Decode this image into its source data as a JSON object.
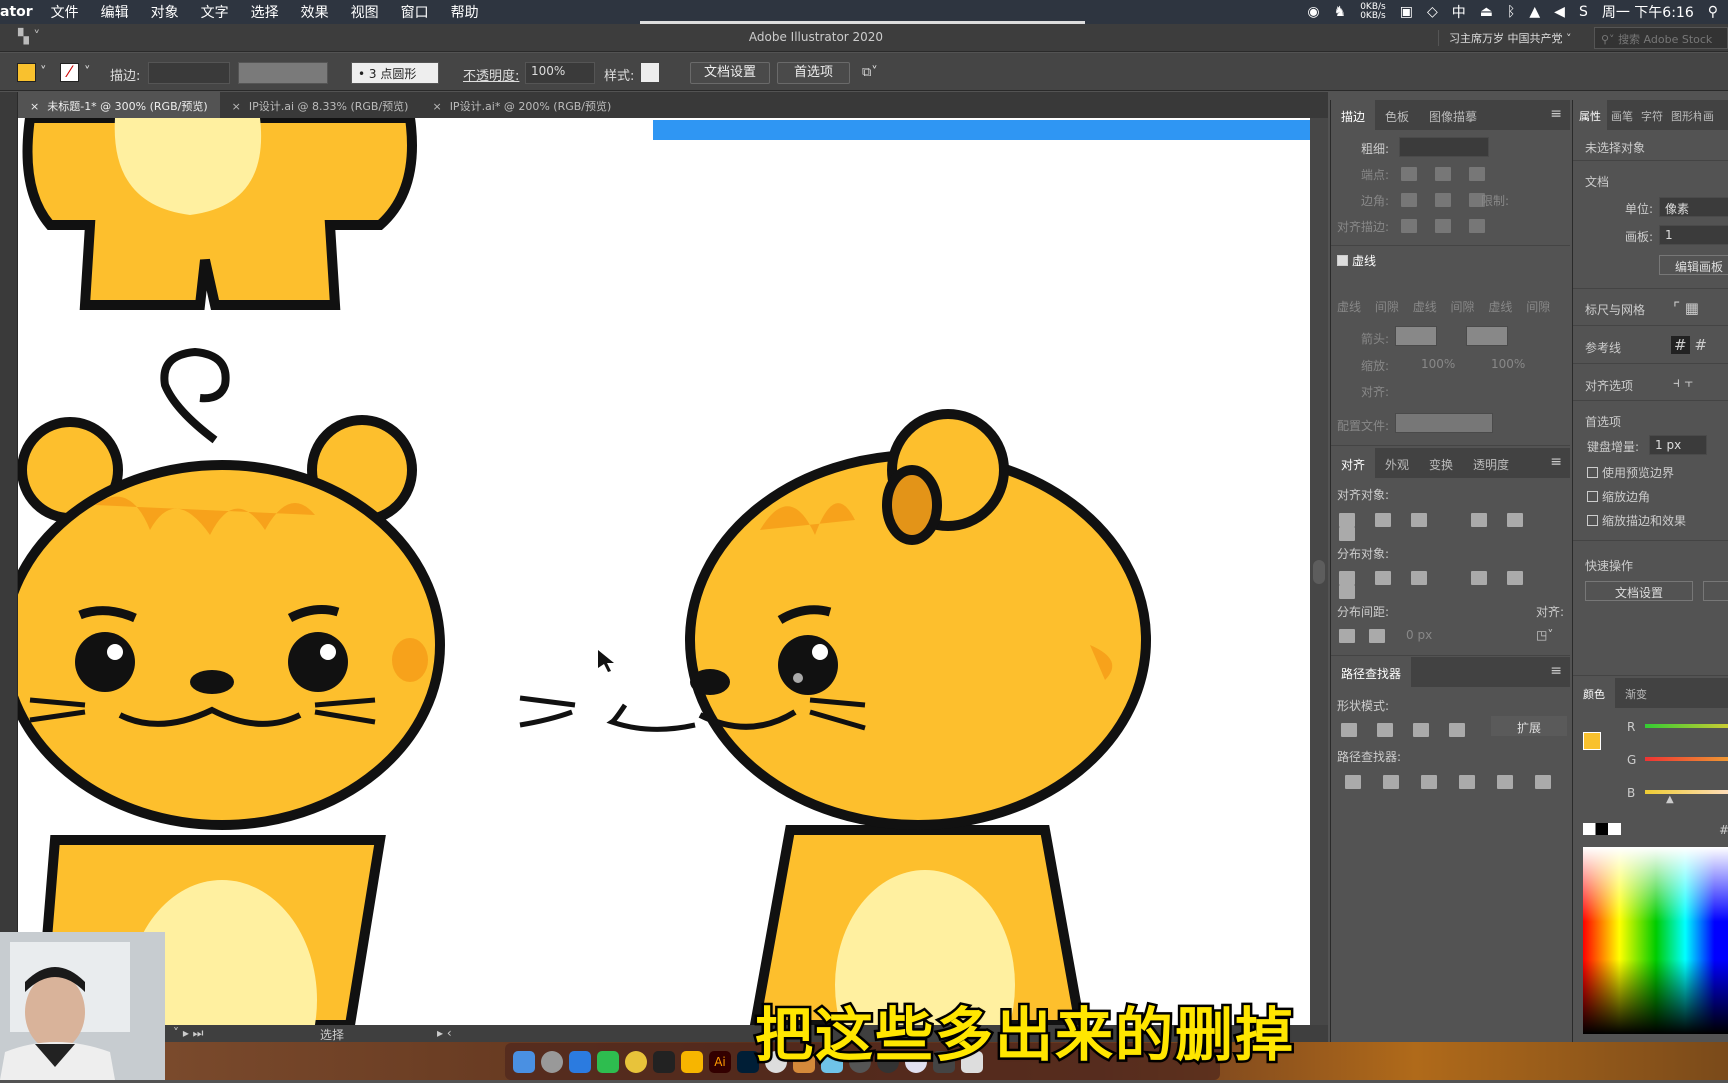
{
  "menubar": {
    "app": "ator",
    "items": [
      "文件",
      "编辑",
      "对象",
      "文字",
      "选择",
      "效果",
      "视图",
      "窗口",
      "帮助"
    ],
    "net_up": "0KB/s",
    "net_down": "0KB/s",
    "input_method": "中",
    "clock": "周一 下午6:16"
  },
  "titlebar": {
    "title": "Adobe Illustrator 2020",
    "workspace": "习主席万岁 中国共产党",
    "search_placeholder": "搜索 Adobe Stock"
  },
  "control": {
    "fill_color": "#f9c12e",
    "stroke_label": "描边:",
    "brush": "3 点圆形",
    "opacity_label": "不透明度:",
    "opacity": "100%",
    "style_label": "样式:",
    "doc_setup": "文档设置",
    "preferences": "首选项"
  },
  "tabs": [
    {
      "label": "未标题-1* @ 300% (RGB/预览)",
      "active": true
    },
    {
      "label": "IP设计.ai @ 8.33% (RGB/预览)",
      "active": false
    },
    {
      "label": "IP设计.ai* @ 200% (RGB/预览)",
      "active": false
    }
  ],
  "stroke_panel": {
    "tabs": [
      "描边",
      "色板",
      "图像描摹"
    ],
    "weight": "粗细:",
    "cap": "端点:",
    "corner": "边角:",
    "limit": "限制:",
    "align_stroke": "对齐描边:",
    "dashed": "虚线",
    "dash_labels": [
      "虚线",
      "间隙",
      "虚线",
      "间隙",
      "虚线",
      "间隙"
    ],
    "arrow": "箭头:",
    "scale": "缩放:",
    "scale_values": [
      "100%",
      "100%"
    ],
    "align": "对齐:",
    "profile": "配置文件:"
  },
  "align_panel": {
    "tabs": [
      "对齐",
      "外观",
      "变换",
      "透明度"
    ],
    "align_objects": "对齐对象:",
    "distribute_objects": "分布对象:",
    "distribute_spacing": "分布间距:",
    "align_to": "对齐:",
    "spacing_value": "0 px"
  },
  "pathfinder_panel": {
    "tab": "路径查找器",
    "shape_modes": "形状模式:",
    "expand": "扩展",
    "pathfinders": "路径查找器:"
  },
  "properties_panel": {
    "tabs": [
      "属性",
      "画笔",
      "字符",
      "图形样式",
      "画"
    ],
    "no_selection": "未选择对象",
    "document": "文档",
    "units_label": "单位:",
    "units": "像素",
    "artboard_label": "画板:",
    "artboard": "1",
    "edit_artboards": "编辑画板",
    "rulers_grids": "标尺与网格",
    "guides": "参考线",
    "snap_options": "对齐选项",
    "preferences": "首选项",
    "keyboard_increment_label": "键盘增量:",
    "keyboard_increment": "1 px",
    "checkboxes": [
      "使用预览边界",
      "缩放边角",
      "缩放描边和效果"
    ],
    "quick_actions": "快速操作",
    "doc_setup": "文档设置"
  },
  "color_panel": {
    "tabs": [
      "颜色",
      "渐变"
    ],
    "channels": [
      "R",
      "G",
      "B"
    ],
    "hash": "#"
  },
  "statusbar": {
    "tool": "选择"
  },
  "subtitle": "把这些多出来的删掉",
  "colors": {
    "cat_body": "#fdbf2d",
    "cat_belly": "#fff0a0",
    "cat_stripe": "#f7a21b",
    "selection_blue": "#2f96f3"
  }
}
